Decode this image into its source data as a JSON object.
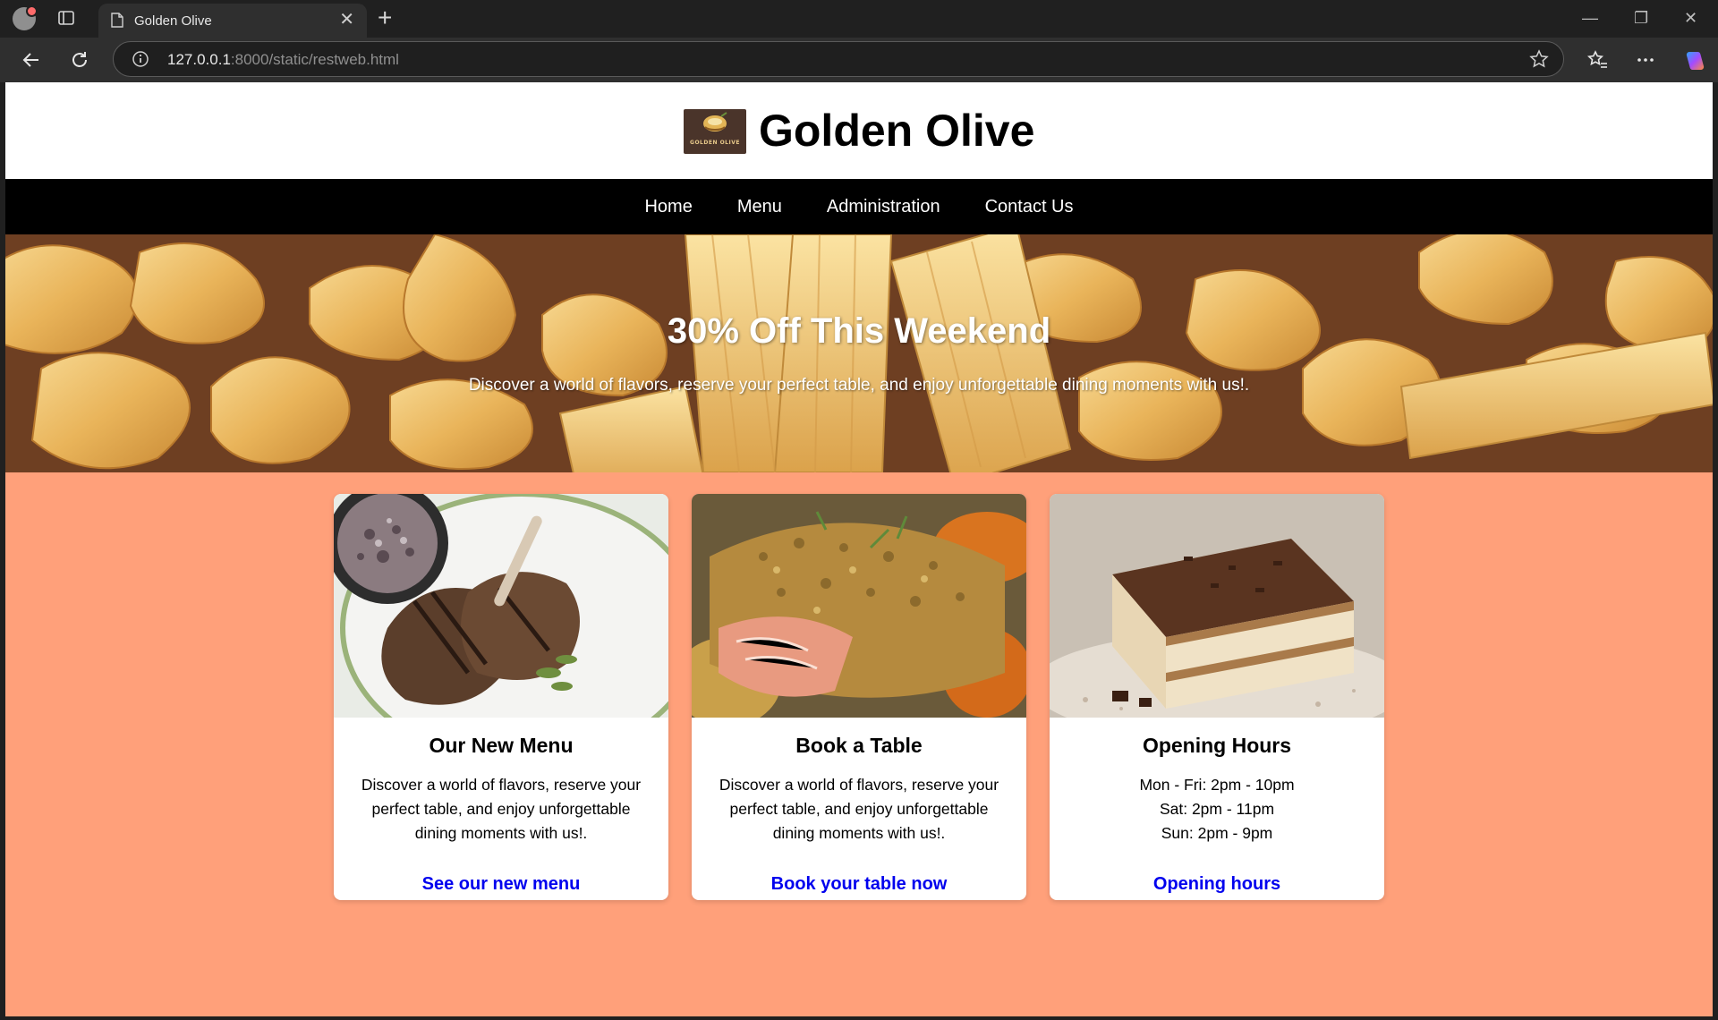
{
  "browser": {
    "tab_title": "Golden Olive",
    "url_host": "127.0.0.1",
    "url_rest": ":8000/static/restweb.html"
  },
  "site": {
    "title": "Golden Olive",
    "logo_text": "GOLDEN OLIVE",
    "nav": [
      {
        "label": "Home"
      },
      {
        "label": "Menu"
      },
      {
        "label": "Administration"
      },
      {
        "label": "Contact Us"
      }
    ],
    "hero": {
      "title": "30% Off This Weekend",
      "subtitle": "Discover a world of flavors, reserve your perfect table, and enjoy unforgettable dining moments with us!."
    },
    "cards": [
      {
        "title": "Our New Menu",
        "text": "Discover a world of flavors, reserve your perfect table, and enjoy unforgettable dining moments with us!.",
        "link": "See our new menu",
        "image": "lamb-chops-photo"
      },
      {
        "title": "Book a Table",
        "text": "Discover a world of flavors, reserve your perfect table, and enjoy unforgettable dining moments with us!.",
        "link": "Book your table now",
        "image": "crusted-salmon-photo"
      },
      {
        "title": "Opening Hours",
        "hours": [
          "Mon - Fri: 2pm - 10pm",
          "Sat: 2pm - 11pm",
          "Sun: 2pm - 9pm"
        ],
        "link": "Opening hours",
        "image": "tiramisu-photo"
      }
    ]
  },
  "colors": {
    "page_bg": "#ffa07a",
    "nav_bg": "#000000",
    "link": "#0000ee"
  }
}
